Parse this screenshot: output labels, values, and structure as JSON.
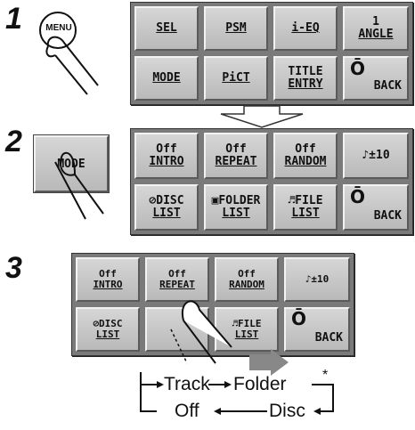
{
  "steps": [
    "1",
    "2",
    "3"
  ],
  "menu_button": "MENU",
  "screen1": {
    "row1": [
      "SEL",
      "PSM",
      "i-EQ",
      {
        "top": "1",
        "bottom": "ANGLE"
      }
    ],
    "row2": [
      "MODE",
      "PiCT",
      {
        "top": "TITLE",
        "bottom": "ENTRY"
      },
      "BACK"
    ]
  },
  "mode_button": "MODE",
  "screen2": {
    "row1": [
      {
        "top": "Off",
        "bottom": "INTRO"
      },
      {
        "top": "Off",
        "bottom": "REPEAT"
      },
      {
        "top": "Off",
        "bottom": "RANDOM"
      },
      "♪±10"
    ],
    "row2": [
      {
        "top": "⊘DISC",
        "bottom": "LIST"
      },
      {
        "top": "▣FOLDER",
        "bottom": "LIST"
      },
      {
        "top": "♬FILE",
        "bottom": "LIST"
      },
      "BACK"
    ]
  },
  "cycle": {
    "track": "Track",
    "folder": "Folder",
    "asterisk": "*",
    "off": "Off",
    "disc": "Disc"
  },
  "colors": {
    "panel": "#7a7a7a",
    "button": "#c8c8c8",
    "arrow": "#888888"
  }
}
